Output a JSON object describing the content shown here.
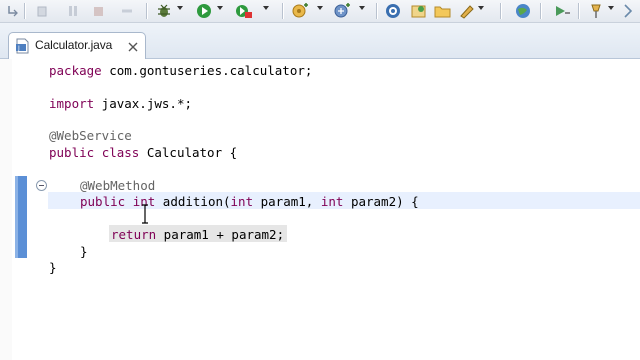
{
  "toolbar": {
    "buttons": [
      "restore-icon",
      "suspend-icon",
      "pause-icon",
      "stop-icon",
      "disconnect-icon",
      "debug-icon",
      "run-icon",
      "coverage-icon",
      "new-server-icon",
      "new-webservice-icon",
      "open-type-icon",
      "open-task-icon",
      "open-folder-icon",
      "pencil-icon",
      "globe-icon",
      "back-forward-icon",
      "pin-icon",
      "search-icon"
    ]
  },
  "editor_tab": {
    "label": "Calculator.java"
  },
  "code": {
    "line1": {
      "kw": "package",
      "text": " com.gontuseries.calculator;"
    },
    "line2": {
      "kw": "import",
      "text": " javax.jws.*;"
    },
    "line3": {
      "annotation": "@WebService"
    },
    "line4": {
      "kw1": "public",
      "kw2": "class",
      "text": " Calculator {"
    },
    "line5": {
      "annotation": "@WebMethod"
    },
    "line6": {
      "kw1": "public",
      "kw2": "int",
      "t1": " addition(",
      "kw3": "int",
      "t2": " param1, ",
      "kw4": "int",
      "t3": " param2) {"
    },
    "line7": {
      "kw": "return",
      "text": " param1 + param2;"
    },
    "line8": {
      "text": "}"
    },
    "line9": {
      "text": "}"
    }
  },
  "colors": {
    "keyword": "#7f0055",
    "annotation": "#646464",
    "current_line": "#e8f0fe",
    "fold_indicator": "#5b8fd6"
  }
}
